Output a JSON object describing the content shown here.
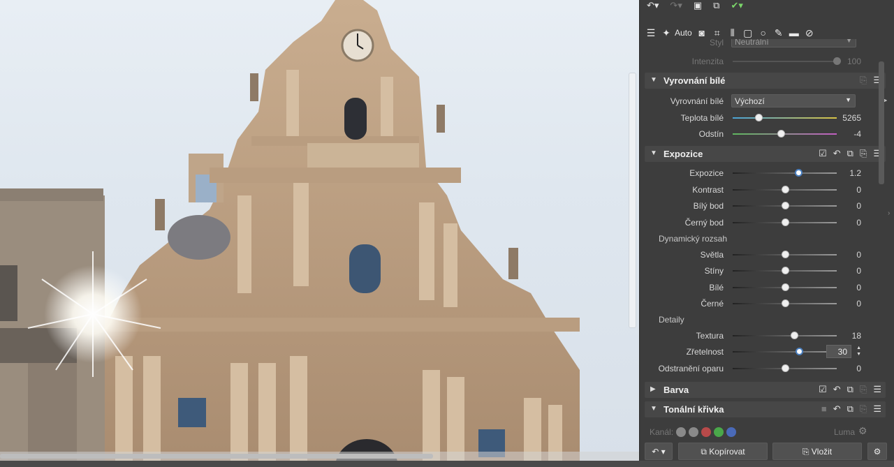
{
  "toolbar": {
    "auto_label": "Auto",
    "icons": [
      "sliders-icon",
      "magic-wand-icon",
      "camera-icon",
      "crop-icon",
      "perspective-icon",
      "text-frame-icon",
      "circle-mask-icon",
      "brush-icon",
      "eraser-icon",
      "bandage-icon"
    ]
  },
  "style_row": {
    "label": "Styl",
    "value": "Neutrální"
  },
  "intensity_row": {
    "label": "Intenzita",
    "value": "100",
    "level": 1.0
  },
  "white_balance": {
    "title": "Vyrovnání bílé",
    "preset_label": "Vyrovnání bílé",
    "preset_value": "Výchozí",
    "temp": {
      "label": "Teplota bílé",
      "value": "5265",
      "level": 0.25
    },
    "tint": {
      "label": "Odstín",
      "value": "-4",
      "level": 0.46
    }
  },
  "exposure": {
    "title": "Expozice",
    "sliders": [
      {
        "label": "Expozice",
        "value": "1.2",
        "level": 0.63
      },
      {
        "label": "Kontrast",
        "value": "0",
        "level": 0.5
      },
      {
        "label": "Bílý bod",
        "value": "0",
        "level": 0.5
      },
      {
        "label": "Černý bod",
        "value": "0",
        "level": 0.5
      }
    ],
    "dynamic_label": "Dynamický rozsah",
    "dynamic": [
      {
        "label": "Světla",
        "value": "0",
        "level": 0.5
      },
      {
        "label": "Stíny",
        "value": "0",
        "level": 0.5
      },
      {
        "label": "Bílé",
        "value": "0",
        "level": 0.5
      },
      {
        "label": "Černé",
        "value": "0",
        "level": 0.5
      }
    ],
    "details_label": "Detaily",
    "details": [
      {
        "label": "Textura",
        "value": "18",
        "level": 0.59
      },
      {
        "label": "Zřetelnost",
        "value": "30",
        "level": 0.64
      },
      {
        "label": "Odstranění oparu",
        "value": "0",
        "level": 0.5
      }
    ]
  },
  "color_section": {
    "title": "Barva"
  },
  "tone_curve": {
    "title": "Tonální křivka",
    "channel_label": "Kanál:",
    "luma_label": "Luma",
    "swatch_colors": [
      "#8a8a8a",
      "#8a8a8a",
      "#b84a4a",
      "#4aa84a",
      "#4a6ab8"
    ]
  },
  "buttons": {
    "copy": "Kopírovat",
    "paste": "Vložit"
  },
  "colors": {
    "panel_bg": "#3d3d3d",
    "section_bg": "#474747",
    "accent": "#4a7fc0"
  }
}
